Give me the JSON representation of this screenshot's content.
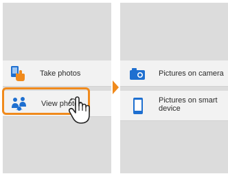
{
  "left_menu": {
    "items": [
      {
        "label": "Take photos",
        "icon": "take-photos-icon",
        "selected": false
      },
      {
        "label": "View photos",
        "icon": "view-photos-icon",
        "selected": true
      }
    ]
  },
  "right_menu": {
    "items": [
      {
        "label": "Pictures on camera",
        "icon": "camera-icon"
      },
      {
        "label": "Pictures on smart device",
        "icon": "smart-device-icon"
      }
    ]
  },
  "colors": {
    "accent_orange": "#f08a1c",
    "icon_blue": "#1e6fd0",
    "panel_gray": "#dcdcdc",
    "row_light": "#f2f2f2"
  }
}
